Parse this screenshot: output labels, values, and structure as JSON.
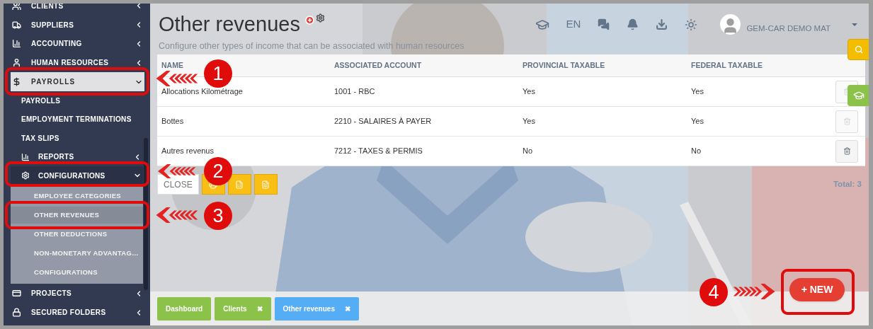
{
  "sidebar": {
    "items": [
      {
        "label": "CLIENTS",
        "expanded": false
      },
      {
        "label": "SUPPLIERS",
        "expanded": false
      },
      {
        "label": "ACCOUNTING",
        "expanded": false
      },
      {
        "label": "HUMAN RESOURCES",
        "expanded": false
      },
      {
        "label": "PAYROLLS",
        "expanded": true,
        "children": [
          {
            "label": "PAYROLLS"
          },
          {
            "label": "EMPLOYMENT TERMINATIONS"
          },
          {
            "label": "TAX SLIPS"
          },
          {
            "label": "REPORTS",
            "expanded": false
          },
          {
            "label": "CONFIGURATIONS",
            "expanded": true,
            "children": [
              {
                "label": "EMPLOYEE CATEGORIES",
                "selected": false
              },
              {
                "label": "OTHER REVENUES",
                "selected": true
              },
              {
                "label": "OTHER DEDUCTIONS",
                "selected": false
              },
              {
                "label": "NON-MONETARY ADVANTAG…",
                "selected": false
              },
              {
                "label": "CONFIGURATIONS",
                "selected": false
              }
            ]
          }
        ]
      },
      {
        "label": "PROJECTS",
        "expanded": false
      },
      {
        "label": "SECURED FOLDERS",
        "expanded": false
      }
    ]
  },
  "header": {
    "title": "Other revenues",
    "subtitle": "Configure other types of income that can be associated with human resources",
    "language": "EN",
    "company": "GEM-CAR DEMO MAT"
  },
  "table": {
    "columns": [
      "NAME",
      "ASSOCIATED ACCOUNT",
      "PROVINCIAL TAXABLE",
      "FEDERAL TAXABLE"
    ],
    "rows": [
      {
        "cells": [
          "Allocations Kilométrage",
          "1001 - RBC",
          "Yes",
          "Yes"
        ],
        "delete_disabled": true
      },
      {
        "cells": [
          "Bottes",
          "2210 - SALAIRES À PAYER",
          "Yes",
          "Yes"
        ],
        "delete_disabled": true
      },
      {
        "cells": [
          "Autres revenus",
          "7212 - TAXES & PERMIS",
          "No",
          "No"
        ],
        "delete_disabled": false
      }
    ]
  },
  "actions": {
    "close": "CLOSE",
    "total": "Total: 3"
  },
  "tabs": [
    {
      "label": "Dashboard",
      "selected": false,
      "closable": false
    },
    {
      "label": "Clients",
      "selected": false,
      "closable": true
    },
    {
      "label": "Other revenues",
      "selected": true,
      "closable": true
    }
  ],
  "close_mark": "✖",
  "new_button": "+ NEW",
  "annotations": [
    {
      "number": "1"
    },
    {
      "number": "2"
    },
    {
      "number": "3"
    },
    {
      "number": "4"
    }
  ]
}
